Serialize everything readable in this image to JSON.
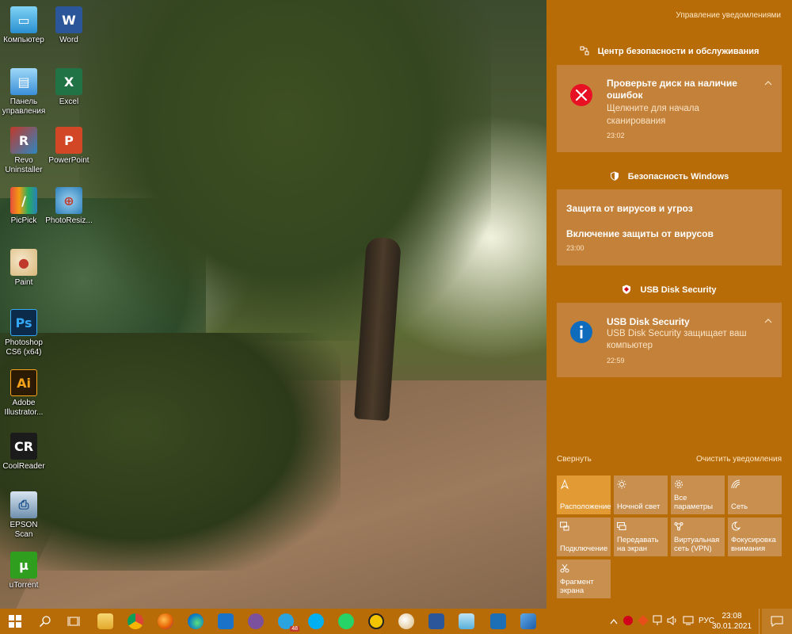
{
  "desktop": {
    "icons": [
      {
        "label": "Компьютер",
        "icon": "computer-icon"
      },
      {
        "label": "Word",
        "icon": "word-icon"
      },
      {
        "label": "Панель управления",
        "icon": "control-panel-icon"
      },
      {
        "label": "Excel",
        "icon": "excel-icon"
      },
      {
        "label": "Revo Uninstaller",
        "icon": "revo-uninstaller-icon"
      },
      {
        "label": "PowerPoint",
        "icon": "powerpoint-icon"
      },
      {
        "label": "PicPick",
        "icon": "picpick-icon"
      },
      {
        "label": "PhotoResiz...",
        "icon": "photoresizer-icon"
      },
      {
        "label": "Paint",
        "icon": "paint-icon"
      },
      {
        "label": "Photoshop CS6 (x64)",
        "icon": "photoshop-icon"
      },
      {
        "label": "Adobe Illustrator...",
        "icon": "illustrator-icon"
      },
      {
        "label": "CoolReader",
        "icon": "coolreader-icon"
      },
      {
        "label": "EPSON Scan",
        "icon": "epson-scan-icon"
      },
      {
        "label": "uTorrent",
        "icon": "utorrent-icon"
      }
    ]
  },
  "action_center": {
    "manage_label": "Управление уведомлениями",
    "groups": [
      {
        "header": "Центр безопасности и обслуживания",
        "notifications": [
          {
            "title": "Проверьте диск на наличие ошибок",
            "body": "Щелкните для начала сканирования",
            "time": "23:02",
            "icon": "error-icon"
          }
        ]
      },
      {
        "header": "Безопасность Windows",
        "notifications": [
          {
            "title": "Защита от вирусов и угроз",
            "body": "Включение защиты от вирусов",
            "time": "23:00"
          }
        ]
      },
      {
        "header": "USB Disk Security",
        "notifications": [
          {
            "title": "USB Disk Security",
            "body": "USB Disk Security защищает ваш компьютер",
            "time": "22:59",
            "icon": "info-icon"
          }
        ]
      }
    ],
    "collapse_label": "Свернуть",
    "clear_label": "Очистить уведомления",
    "quick_actions": [
      {
        "label": "Расположение",
        "icon": "location-icon",
        "active": true
      },
      {
        "label": "Ночной свет",
        "icon": "night-light-icon",
        "active": false
      },
      {
        "label": "Все параметры",
        "icon": "settings-icon",
        "active": false
      },
      {
        "label": "Сеть",
        "icon": "network-icon",
        "active": false
      },
      {
        "label": "Подключение",
        "icon": "connect-icon",
        "active": false
      },
      {
        "label": "Передавать на экран",
        "icon": "project-icon",
        "active": false
      },
      {
        "label": "Виртуальная сеть (VPN)",
        "icon": "vpn-icon",
        "active": false
      },
      {
        "label": "Фокусировка внимания",
        "icon": "focus-assist-icon",
        "active": false
      },
      {
        "label": "Фрагмент экрана",
        "icon": "snip-icon",
        "active": false
      }
    ]
  },
  "taskbar": {
    "apps": [
      "file-explorer",
      "chrome",
      "firefox",
      "edge",
      "mail",
      "viber",
      "telegram",
      "skype",
      "whatsapp",
      "archive",
      "paint",
      "word",
      "notepad",
      "calculator",
      "photos"
    ],
    "telegram_badge": "48",
    "language": "РУС",
    "time": "23:08",
    "date": "30.01.2021"
  },
  "colors": {
    "accent": "#b86c08",
    "card": "#c3813a",
    "tile": "#c88f4f",
    "tile_active": "#e19a34"
  }
}
